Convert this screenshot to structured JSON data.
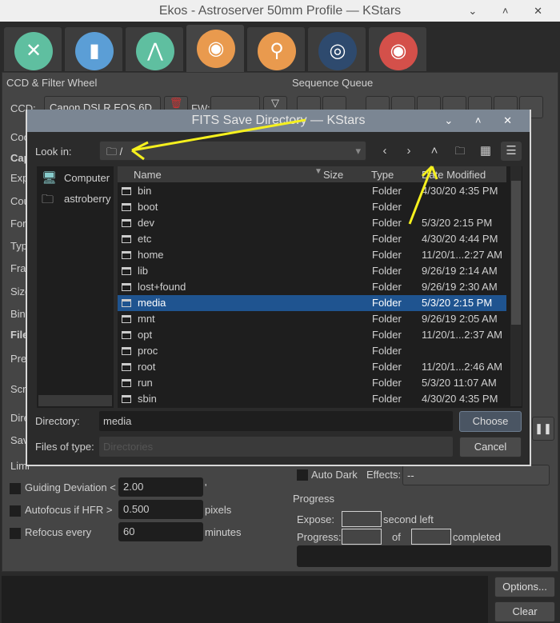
{
  "window": {
    "title": "Ekos - Astroserver 50mm Profile — KStars",
    "controls": "⌄ ˄ ✕"
  },
  "tabs": [
    {
      "name": "setup",
      "color": "#5fbfa0",
      "glyph": "✕",
      "active": false
    },
    {
      "name": "scheduler",
      "color": "#5b9ed6",
      "glyph": "▮",
      "active": false
    },
    {
      "name": "mount",
      "color": "#5fbfa0",
      "glyph": "⋀",
      "active": false
    },
    {
      "name": "capture",
      "color": "#e99a4e",
      "glyph": "◉",
      "active": true
    },
    {
      "name": "focus",
      "color": "#e99a4e",
      "glyph": "⚲",
      "active": false
    },
    {
      "name": "align",
      "color": "#2e4a6e",
      "glyph": "◎",
      "active": false
    },
    {
      "name": "guide",
      "color": "#d4504a",
      "glyph": "◉",
      "active": false
    }
  ],
  "capture": {
    "ccd_section": "CCD & Filter Wheel",
    "ccd_label": "CCD:",
    "ccd_value": "Canon DSLR EOS 6D",
    "fw_label": "FW:",
    "side_labels": [
      "Coo",
      "Cap",
      "Exp",
      "Cou",
      "For",
      "Typ",
      "Fra",
      "Size",
      "Bin",
      "File",
      "Pre",
      "Scr",
      "Dire",
      "Sav",
      "Limi"
    ],
    "sequence_queue": "Sequence Queue",
    "limits": [
      {
        "label": "Guiding Deviation <",
        "value": "2.00",
        "unit": "'"
      },
      {
        "label": "Autofocus if HFR >",
        "value": "0.500",
        "unit": "pixels"
      },
      {
        "label": "Refocus every",
        "value": "60",
        "unit": "minutes"
      }
    ],
    "auto_dark": "Auto Dark",
    "effects_label": "Effects:",
    "effects_value": "--",
    "progress": {
      "title": "Progress",
      "expose_label": "Expose:",
      "second_left": "second left",
      "progress_label": "Progress:",
      "of": "of",
      "completed": "completed"
    },
    "options_button": "Options...",
    "clear_button": "Clear"
  },
  "dialog": {
    "title": "FITS Save Directory — KStars",
    "controls": "⌄ ˄ ✕",
    "look_in_label": "Look in:",
    "look_in_value": "/",
    "places": [
      {
        "label": "Computer",
        "icon": "computer-icon"
      },
      {
        "label": "astroberry",
        "icon": "folder-icon"
      }
    ],
    "columns": [
      "Name",
      "Size",
      "Type",
      "Date Modified"
    ],
    "rows": [
      {
        "name": "bin",
        "type": "Folder",
        "modified": "4/30/20 4:35 PM"
      },
      {
        "name": "boot",
        "type": "Folder",
        "modified": ""
      },
      {
        "name": "dev",
        "type": "Folder",
        "modified": "5/3/20 2:15 PM"
      },
      {
        "name": "etc",
        "type": "Folder",
        "modified": "4/30/20 4:44 PM"
      },
      {
        "name": "home",
        "type": "Folder",
        "modified": "11/20/1...2:27 AM"
      },
      {
        "name": "lib",
        "type": "Folder",
        "modified": "9/26/19 2:14 AM"
      },
      {
        "name": "lost+found",
        "type": "Folder",
        "modified": "9/26/19 2:30 AM"
      },
      {
        "name": "media",
        "type": "Folder",
        "modified": "5/3/20 2:15 PM",
        "selected": true
      },
      {
        "name": "mnt",
        "type": "Folder",
        "modified": "9/26/19 2:05 AM"
      },
      {
        "name": "opt",
        "type": "Folder",
        "modified": "11/20/1...2:37 AM"
      },
      {
        "name": "proc",
        "type": "Folder",
        "modified": ""
      },
      {
        "name": "root",
        "type": "Folder",
        "modified": "11/20/1...2:46 AM"
      },
      {
        "name": "run",
        "type": "Folder",
        "modified": "5/3/20 11:07 AM"
      },
      {
        "name": "sbin",
        "type": "Folder",
        "modified": "4/30/20 4:35 PM"
      }
    ],
    "directory_label": "Directory:",
    "directory_value": "media",
    "files_of_type_label": "Files of type:",
    "files_of_type_value": "Directories",
    "choose_button": "Choose",
    "cancel_button": "Cancel",
    "annotation_color": "#f5f01e"
  }
}
